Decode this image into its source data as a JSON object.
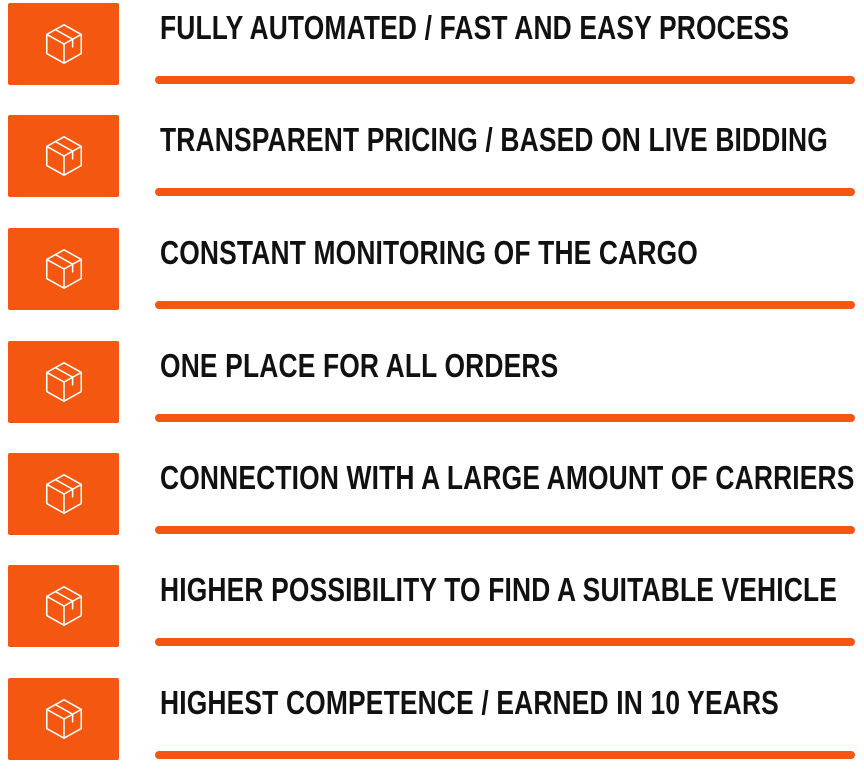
{
  "accent_color": "#f4570f",
  "items": [
    {
      "label": "FULLY AUTOMATED / FAST AND EASY PROCESS",
      "icon": "box-icon"
    },
    {
      "label": "TRANSPARENT PRICING / BASED ON LIVE BIDDING",
      "icon": "box-icon"
    },
    {
      "label": "CONSTANT MONITORING OF THE CARGO",
      "icon": "box-icon"
    },
    {
      "label": "ONE PLACE FOR ALL ORDERS",
      "icon": "box-icon"
    },
    {
      "label": "CONNECTION WITH A LARGE AMOUNT OF CARRIERS",
      "icon": "box-icon"
    },
    {
      "label": "HIGHER POSSIBILITY TO FIND A SUITABLE VEHICLE",
      "icon": "box-icon"
    },
    {
      "label": "HIGHEST COMPETENCE / EARNED IN 10 YEARS",
      "icon": "box-icon"
    }
  ]
}
